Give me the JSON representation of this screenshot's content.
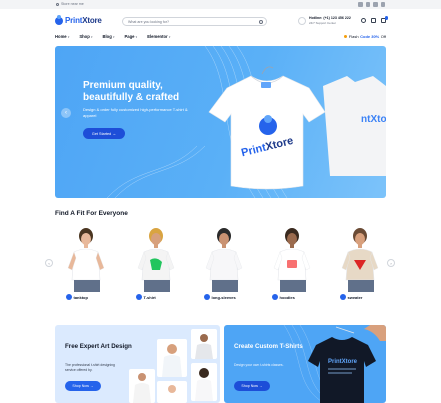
{
  "topbar": {
    "location": "Store near me"
  },
  "header": {
    "brand_a": "Print",
    "brand_b": "Xtore",
    "search_placeholder": "What are you looking for?",
    "hotline_title": "Hotline: (+1) 123 456 222",
    "hotline_sub": "24/7 Support Center"
  },
  "nav": {
    "items": [
      "Home",
      "Shop",
      "Blog",
      "Page",
      "Elementor"
    ],
    "promo_prefix": "Flash",
    "promo_code": "Code 30%",
    "promo_suffix": "Off"
  },
  "hero": {
    "title": "Premium quality, beautifully & crafted",
    "subtitle": "Design & order fully customized high-performance T-shirt & apparel",
    "button": "Get Started →",
    "shirt_brand_a": "Print",
    "shirt_brand_b": "Xtore",
    "shirt_brand_back": "ntXtore"
  },
  "categories": {
    "title": "Find A Fit For Everyone",
    "items": [
      {
        "label": "tanktop",
        "shirt": "#ffffff",
        "hair": "#4b3621",
        "skin": "#e8b89a"
      },
      {
        "label": "T-shirt",
        "shirt": "#f4f4f4",
        "hair": "#d9a441",
        "skin": "#d7a07c"
      },
      {
        "label": "long-sleeves",
        "shirt": "#f7f7f9",
        "hair": "#2b2b2b",
        "skin": "#c99272"
      },
      {
        "label": "hoodies",
        "shirt": "#ffffff",
        "hair": "#3a2a1f",
        "skin": "#9a6a4d"
      },
      {
        "label": "sweater",
        "shirt": "#e7d9c6",
        "hair": "#6b4b35",
        "skin": "#d8a07d"
      }
    ]
  },
  "cards": [
    {
      "title": "Free Expert Art Design",
      "subtitle": "The professional t-shirt designing service offered by.",
      "button": "Shop Now →",
      "bg": "#dbeafe"
    },
    {
      "title": "Create Custom T-Shirts",
      "subtitle": "Design your own t-shirts classes.",
      "button": "Shop Now →",
      "bg": "#4ea5f5"
    }
  ],
  "colors": {
    "accent": "#2563eb",
    "hero_bg": "#5ab0f7"
  }
}
